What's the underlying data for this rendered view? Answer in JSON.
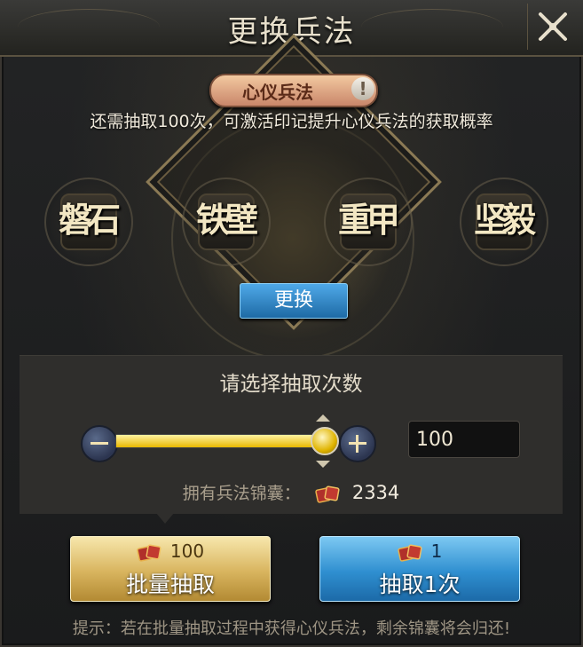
{
  "header": {
    "title": "更换兵法"
  },
  "hero": {
    "tag_label": "心仪兵法",
    "info_glyph": "!",
    "hint": "还需抽取100次，可激活印记提升心仪兵法的获取概率",
    "skills": [
      "磐石",
      "铁壁",
      "重甲",
      "坚毅"
    ],
    "swap_label": "更换"
  },
  "select": {
    "title": "请选择抽取次数",
    "count_value": "100",
    "slider_fraction": 1.0,
    "own_label": "拥有兵法锦囊：",
    "own_value": "2334"
  },
  "buttons": {
    "batch": {
      "cost": "100",
      "label": "批量抽取"
    },
    "single": {
      "cost": "1",
      "label": "抽取1次"
    }
  },
  "footer": {
    "hint": "提示：若在批量抽取过程中获得心仪兵法，剩余锦囊将会归还!"
  },
  "colors": {
    "gold": "#e9b800",
    "blue": "#2f8fd0",
    "tag": "#c9866a"
  }
}
